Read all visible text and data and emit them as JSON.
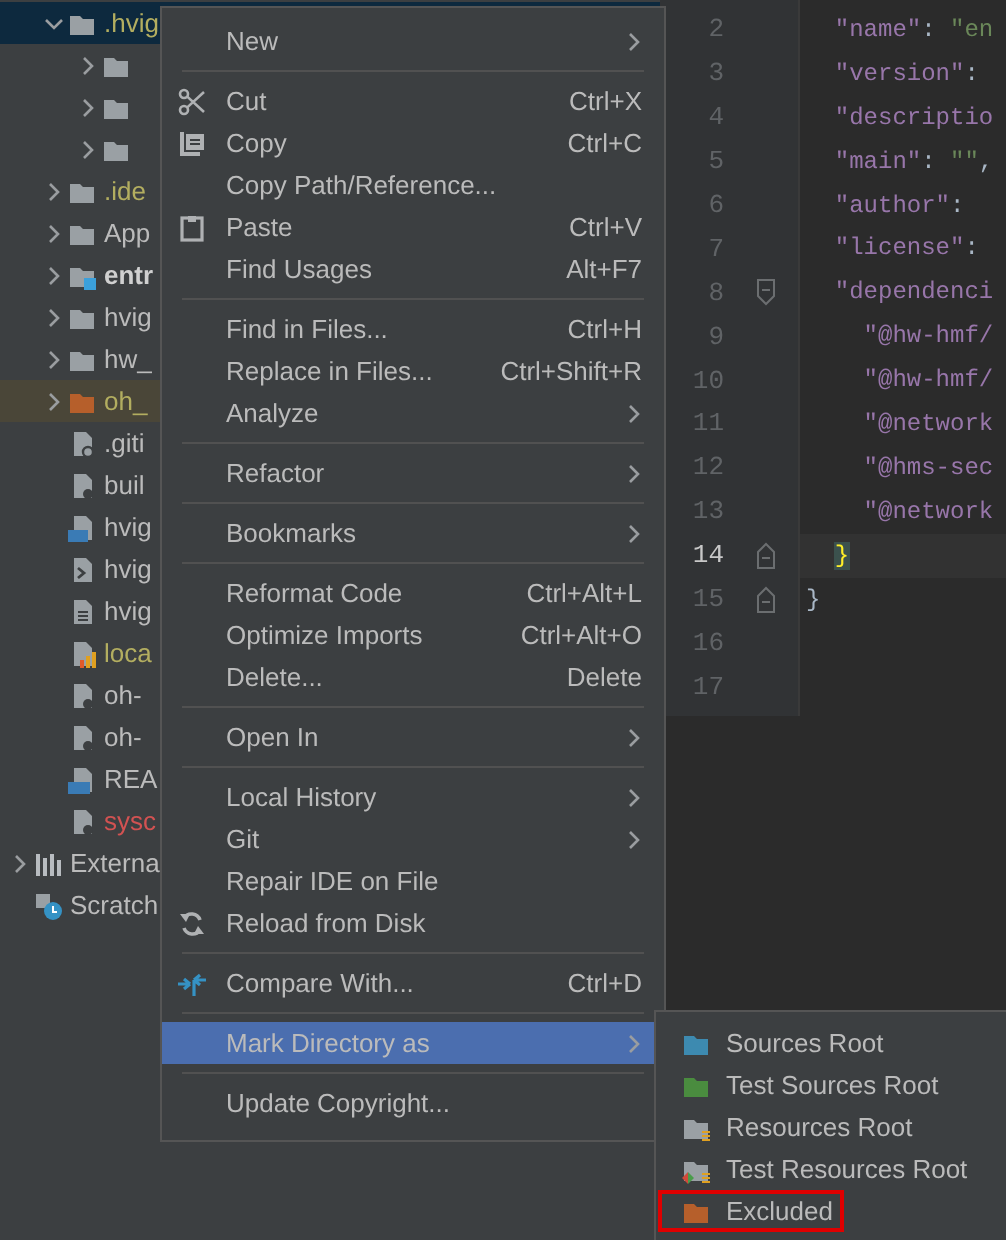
{
  "project_tree": {
    "items": [
      {
        "label": ".hvig",
        "kind": "folder",
        "expanded": true,
        "selected": true,
        "hovered": false,
        "color": "#b3ae60",
        "bold": false,
        "children": [
          {
            "kind": "folder",
            "expanded": false,
            "selected": false,
            "hovered": false
          },
          {
            "kind": "folder",
            "expanded": false,
            "selected": false,
            "hovered": false
          },
          {
            "kind": "folder",
            "expanded": false,
            "selected": false,
            "hovered": false
          }
        ]
      },
      {
        "label": ".ide",
        "kind": "folder",
        "expanded": false,
        "selected": false,
        "hovered": false,
        "color": "#b3ae60",
        "bold": false
      },
      {
        "label": "App",
        "kind": "folder",
        "expanded": false,
        "selected": false,
        "hovered": false,
        "color": "#bbbbbb",
        "bold": false
      },
      {
        "label": "entr",
        "kind": "module",
        "expanded": false,
        "selected": false,
        "hovered": false,
        "color": "#d0d0d0",
        "bold": true
      },
      {
        "label": "hvig",
        "kind": "folder",
        "expanded": false,
        "selected": false,
        "hovered": false,
        "color": "#bbbbbb",
        "bold": false
      },
      {
        "label": "hw_",
        "kind": "folder",
        "expanded": false,
        "selected": false,
        "hovered": false,
        "color": "#bbbbbb",
        "bold": false
      },
      {
        "label": "oh_",
        "kind": "excluded",
        "expanded": false,
        "selected": false,
        "hovered": true,
        "color": "#b3ae60",
        "bold": false
      },
      {
        "label": ".giti",
        "kind": "ignore",
        "selected": false,
        "hovered": false,
        "color": "#bbbbbb",
        "bold": false
      },
      {
        "label": "buil",
        "kind": "config",
        "selected": false,
        "hovered": false,
        "color": "#bbbbbb",
        "bold": false
      },
      {
        "label": "hvig",
        "kind": "typescript",
        "selected": false,
        "hovered": false,
        "color": "#bbbbbb",
        "bold": false
      },
      {
        "label": "hvig",
        "kind": "shell",
        "selected": false,
        "hovered": false,
        "color": "#bbbbbb",
        "bold": false
      },
      {
        "label": "hvig",
        "kind": "text",
        "selected": false,
        "hovered": false,
        "color": "#bbbbbb",
        "bold": false
      },
      {
        "label": "loca",
        "kind": "properties",
        "selected": false,
        "hovered": false,
        "color": "#b3ae60",
        "bold": false
      },
      {
        "label": "oh-",
        "kind": "config",
        "selected": false,
        "hovered": false,
        "color": "#bbbbbb",
        "bold": false
      },
      {
        "label": "oh-",
        "kind": "config",
        "selected": false,
        "hovered": false,
        "color": "#bbbbbb",
        "bold": false
      },
      {
        "label": "REA",
        "kind": "markdown",
        "selected": false,
        "hovered": false,
        "color": "#bbbbbb",
        "bold": false
      },
      {
        "label": "sysc",
        "kind": "config",
        "selected": false,
        "hovered": false,
        "color": "#d25252",
        "bold": false
      }
    ],
    "roots": [
      {
        "label": "Externa",
        "kind": "libraries",
        "expanded": false
      },
      {
        "label": "Scratch",
        "kind": "scratches"
      }
    ]
  },
  "editor": {
    "lines": [
      {
        "number": "2",
        "kind": "inner",
        "current": false,
        "segments": [
          {
            "kind": "key",
            "text": "\"name\""
          },
          {
            "kind": "punct",
            "text": ": "
          },
          {
            "kind": "string",
            "text": "\"en"
          }
        ]
      },
      {
        "number": "3",
        "kind": "inner",
        "current": false,
        "segments": [
          {
            "kind": "key",
            "text": "\"version\""
          },
          {
            "kind": "punct",
            "text": ":"
          }
        ]
      },
      {
        "number": "4",
        "kind": "inner",
        "current": false,
        "segments": [
          {
            "kind": "key",
            "text": "\"descriptio"
          }
        ]
      },
      {
        "number": "5",
        "kind": "inner",
        "current": false,
        "segments": [
          {
            "kind": "key",
            "text": "\"main\""
          },
          {
            "kind": "punct",
            "text": ": "
          },
          {
            "kind": "string",
            "text": "\"\""
          },
          {
            "kind": "punct",
            "text": ","
          }
        ]
      },
      {
        "number": "6",
        "kind": "inner",
        "current": false,
        "segments": [
          {
            "kind": "key",
            "text": "\"author\""
          },
          {
            "kind": "punct",
            "text": ":"
          }
        ]
      },
      {
        "number": "7",
        "kind": "inner",
        "current": false,
        "segments": [
          {
            "kind": "key",
            "text": "\"license\""
          },
          {
            "kind": "punct",
            "text": ":"
          }
        ]
      },
      {
        "number": "8",
        "kind": "inner",
        "current": false,
        "fold": {
          "kind": "start"
        },
        "segments": [
          {
            "kind": "key",
            "text": "\"dependenci"
          }
        ]
      },
      {
        "number": "9",
        "kind": "nested",
        "current": false,
        "segments": [
          {
            "kind": "key",
            "text": "\"@hw-hmf/"
          }
        ]
      },
      {
        "number": "10",
        "kind": "nested",
        "current": false,
        "segments": [
          {
            "kind": "key",
            "text": "\"@hw-hmf/"
          }
        ]
      },
      {
        "number": "11",
        "kind": "nested",
        "current": false,
        "segments": [
          {
            "kind": "key",
            "text": "\"@network"
          }
        ]
      },
      {
        "number": "12",
        "kind": "nested",
        "current": false,
        "segments": [
          {
            "kind": "key",
            "text": "\"@hms-sec"
          }
        ]
      },
      {
        "number": "13",
        "kind": "nested",
        "current": false,
        "segments": [
          {
            "kind": "key",
            "text": "\"@network"
          }
        ]
      },
      {
        "number": "14",
        "kind": "inner",
        "current": true,
        "fold": {
          "kind": "end"
        },
        "segments": [
          {
            "kind": "match",
            "text": "}"
          }
        ]
      },
      {
        "number": "15",
        "kind": "outer",
        "current": false,
        "fold": {
          "kind": "end"
        },
        "segments": [
          {
            "kind": "punct",
            "text": "}"
          }
        ]
      },
      {
        "number": "16",
        "kind": "outer",
        "current": false
      },
      {
        "number": "17",
        "kind": "outer",
        "current": false
      }
    ]
  },
  "context_menu": {
    "items": [
      {
        "kind": "item",
        "label": "New",
        "submenu": true,
        "selected": false
      },
      {
        "kind": "separator"
      },
      {
        "kind": "cut",
        "label": "Cut",
        "shortcut": "Ctrl+X",
        "selected": false
      },
      {
        "kind": "copy",
        "label": "Copy",
        "shortcut": "Ctrl+C",
        "selected": false
      },
      {
        "kind": "item",
        "label": "Copy Path/Reference...",
        "selected": false
      },
      {
        "kind": "paste",
        "label": "Paste",
        "shortcut": "Ctrl+V",
        "selected": false
      },
      {
        "kind": "item",
        "label": "Find Usages",
        "shortcut": "Alt+F7",
        "selected": false
      },
      {
        "kind": "separator"
      },
      {
        "kind": "item",
        "label": "Find in Files...",
        "shortcut": "Ctrl+H",
        "selected": false
      },
      {
        "kind": "item",
        "label": "Replace in Files...",
        "shortcut": "Ctrl+Shift+R",
        "selected": false
      },
      {
        "kind": "item",
        "label": "Analyze",
        "submenu": true,
        "selected": false
      },
      {
        "kind": "separator"
      },
      {
        "kind": "item",
        "label": "Refactor",
        "submenu": true,
        "selected": false
      },
      {
        "kind": "separator"
      },
      {
        "kind": "item",
        "label": "Bookmarks",
        "submenu": true,
        "selected": false
      },
      {
        "kind": "separator"
      },
      {
        "kind": "item",
        "label": "Reformat Code",
        "shortcut": "Ctrl+Alt+L",
        "selected": false
      },
      {
        "kind": "item",
        "label": "Optimize Imports",
        "shortcut": "Ctrl+Alt+O",
        "selected": false
      },
      {
        "kind": "item",
        "label": "Delete...",
        "shortcut": "Delete",
        "selected": false
      },
      {
        "kind": "separator"
      },
      {
        "kind": "item",
        "label": "Open In",
        "submenu": true,
        "selected": false
      },
      {
        "kind": "separator"
      },
      {
        "kind": "item",
        "label": "Local History",
        "submenu": true,
        "selected": false
      },
      {
        "kind": "item",
        "label": "Git",
        "submenu": true,
        "selected": false
      },
      {
        "kind": "item",
        "label": "Repair IDE on File",
        "selected": false
      },
      {
        "kind": "reload",
        "label": "Reload from Disk",
        "selected": false
      },
      {
        "kind": "separator"
      },
      {
        "kind": "compare",
        "label": "Compare With...",
        "shortcut": "Ctrl+D",
        "selected": false
      },
      {
        "kind": "separator"
      },
      {
        "kind": "item",
        "label": "Mark Directory as",
        "submenu": true,
        "selected": true
      },
      {
        "kind": "separator"
      },
      {
        "kind": "item",
        "label": "Update Copyright...",
        "selected": false
      }
    ]
  },
  "submenu": {
    "items": [
      {
        "label": "Sources Root",
        "kind": "sources",
        "annotated": false
      },
      {
        "label": "Test Sources Root",
        "kind": "test-sources",
        "annotated": false
      },
      {
        "label": "Resources Root",
        "kind": "resources",
        "annotated": false
      },
      {
        "label": "Test Resources Root",
        "kind": "test-resources",
        "annotated": false
      },
      {
        "label": "Excluded",
        "kind": "excluded",
        "annotated": true
      }
    ]
  }
}
